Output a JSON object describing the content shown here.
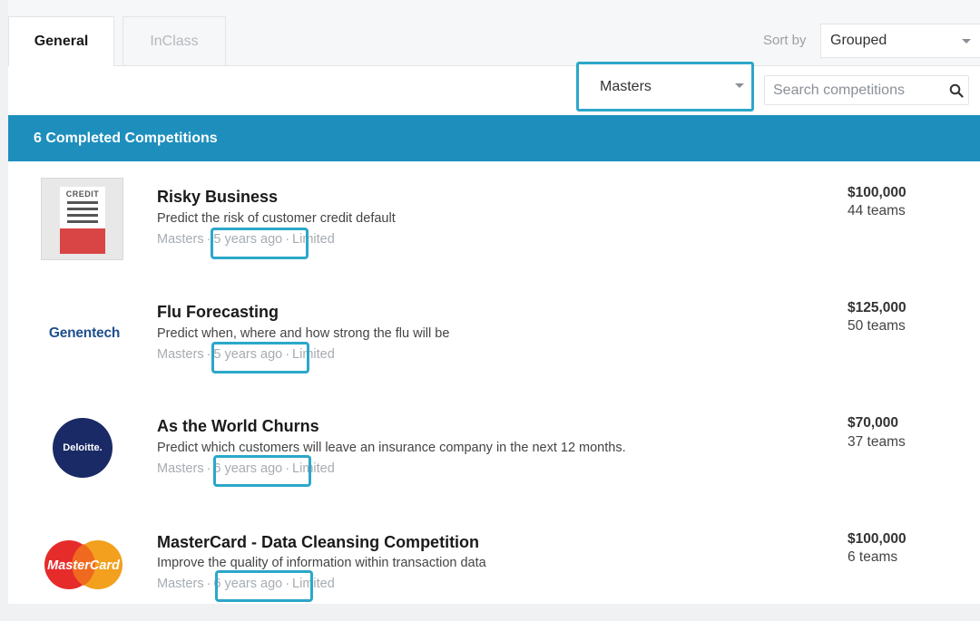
{
  "tabs": {
    "general": "General",
    "inclass": "InClass"
  },
  "sort": {
    "label": "Sort by",
    "value": "Grouped"
  },
  "filter": {
    "category": "Masters",
    "search_placeholder": "Search competitions"
  },
  "section": {
    "title": "6 Completed Competitions"
  },
  "competitions": [
    {
      "title": "Risky Business",
      "description": "Predict the risk of customer credit default",
      "category": "Masters",
      "time": "5 years ago",
      "access": "Limited",
      "prize": "$100,000",
      "teams": "44 teams",
      "logo_text": "CREDIT"
    },
    {
      "title": "Flu Forecasting",
      "description": "Predict when, where and how strong the flu will be",
      "category": "Masters",
      "time": "5 years ago",
      "access": "Limited",
      "prize": "$125,000",
      "teams": "50 teams",
      "logo_text": "Genentech"
    },
    {
      "title": "As the World Churns",
      "description": "Predict which customers will leave an insurance company in the next 12 months.",
      "category": "Masters",
      "time": "6 years ago",
      "access": "Limited",
      "prize": "$70,000",
      "teams": "37 teams",
      "logo_text": "Deloitte."
    },
    {
      "title": "MasterCard - Data Cleansing Competition",
      "description": "Improve the quality of information within transaction data",
      "category": "Masters",
      "time": "6 years ago",
      "access": "Limited",
      "prize": "$100,000",
      "teams": "6 teams",
      "logo_text": "MasterCard"
    }
  ],
  "colors": {
    "band": "#1e8fbd",
    "highlight": "#2ba7c9"
  }
}
